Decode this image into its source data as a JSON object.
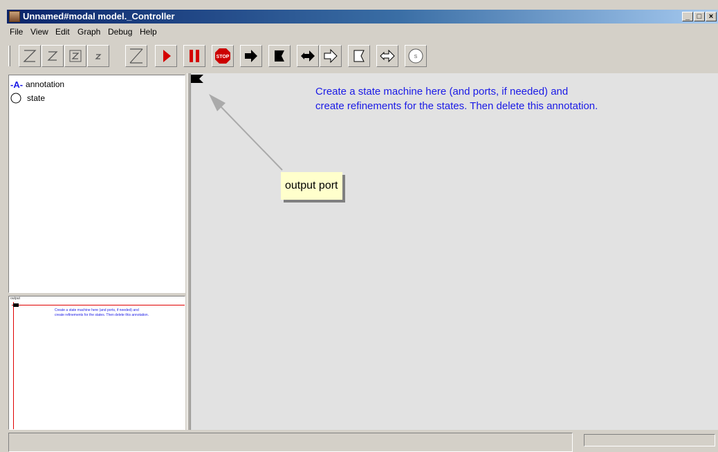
{
  "window": {
    "title": "Unnamed#modal model._Controller",
    "controls": {
      "minimize": "_",
      "maximize": "□",
      "close": "×"
    }
  },
  "menu": [
    "File",
    "View",
    "Edit",
    "Graph",
    "Debug",
    "Help"
  ],
  "toolbar": {
    "buttons": [
      "zoom-reset-icon",
      "zoom-in-icon",
      "zoom-fit-icon",
      "zoom-out-icon",
      "full-screen-icon",
      "run-icon",
      "pause-icon",
      "stop-icon",
      "input-port-icon",
      "output-port-icon",
      "io-port-icon",
      "input-multiport-icon",
      "output-multiport-icon",
      "io-multiport-icon",
      "state-icon"
    ],
    "stop_label": "STOP",
    "state_label": "S",
    "colors": {
      "run": "#d40000",
      "pause": "#d40000",
      "stop": "#cc0000"
    }
  },
  "library": {
    "items": [
      {
        "icon": "annotation-icon",
        "icon_text": "-A-",
        "label": "annotation"
      },
      {
        "icon": "state-icon",
        "icon_text": "",
        "label": "state"
      }
    ]
  },
  "overview": {
    "port_label": "output",
    "annotation": "Create a state machine here (and ports, if needed) and\ncreate refinements for the states. Then delete this annotation."
  },
  "canvas": {
    "annotation": "Create a state machine here (and ports, if needed) and\ncreate refinements for the states. Then delete this annotation.",
    "tooltip": "output port",
    "annotation_color": "#1a1ae6"
  }
}
